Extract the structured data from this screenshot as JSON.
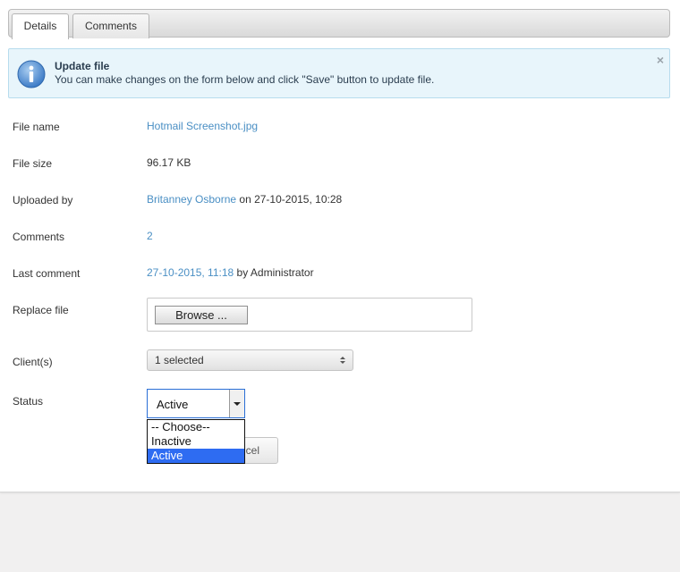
{
  "tabs": [
    {
      "label": "Details",
      "active": true
    },
    {
      "label": "Comments",
      "active": false
    }
  ],
  "info": {
    "title": "Update file",
    "text": "You can make changes on the form below and click \"Save\" button to update file.",
    "close": "×",
    "icon": "info-icon",
    "color": "#e8f5fb"
  },
  "fields": {
    "file_name": {
      "label": "File name",
      "value": "Hotmail Screenshot.jpg"
    },
    "file_size": {
      "label": "File size",
      "value": "96.17 KB"
    },
    "uploaded_by": {
      "label": "Uploaded by",
      "user": "Britanney Osborne",
      "suffix": "on 27-10-2015, 10:28"
    },
    "comments": {
      "label": "Comments",
      "value": "2"
    },
    "last_comment": {
      "label": "Last comment",
      "date": "27-10-2015, 11:18",
      "suffix": "by Administrator"
    },
    "replace_file": {
      "label": "Replace file",
      "button": "Browse ..."
    },
    "clients": {
      "label": "Client(s)",
      "value": "1 selected"
    },
    "status": {
      "label": "Status",
      "value": "Active",
      "options": [
        "-- Choose--",
        "Inactive",
        "Active"
      ],
      "selected_index": 2
    }
  },
  "buttons": {
    "cancel_visible": "cel"
  },
  "colors": {
    "link": "#4a8fc4",
    "selected_option": "#2e6cf2"
  }
}
